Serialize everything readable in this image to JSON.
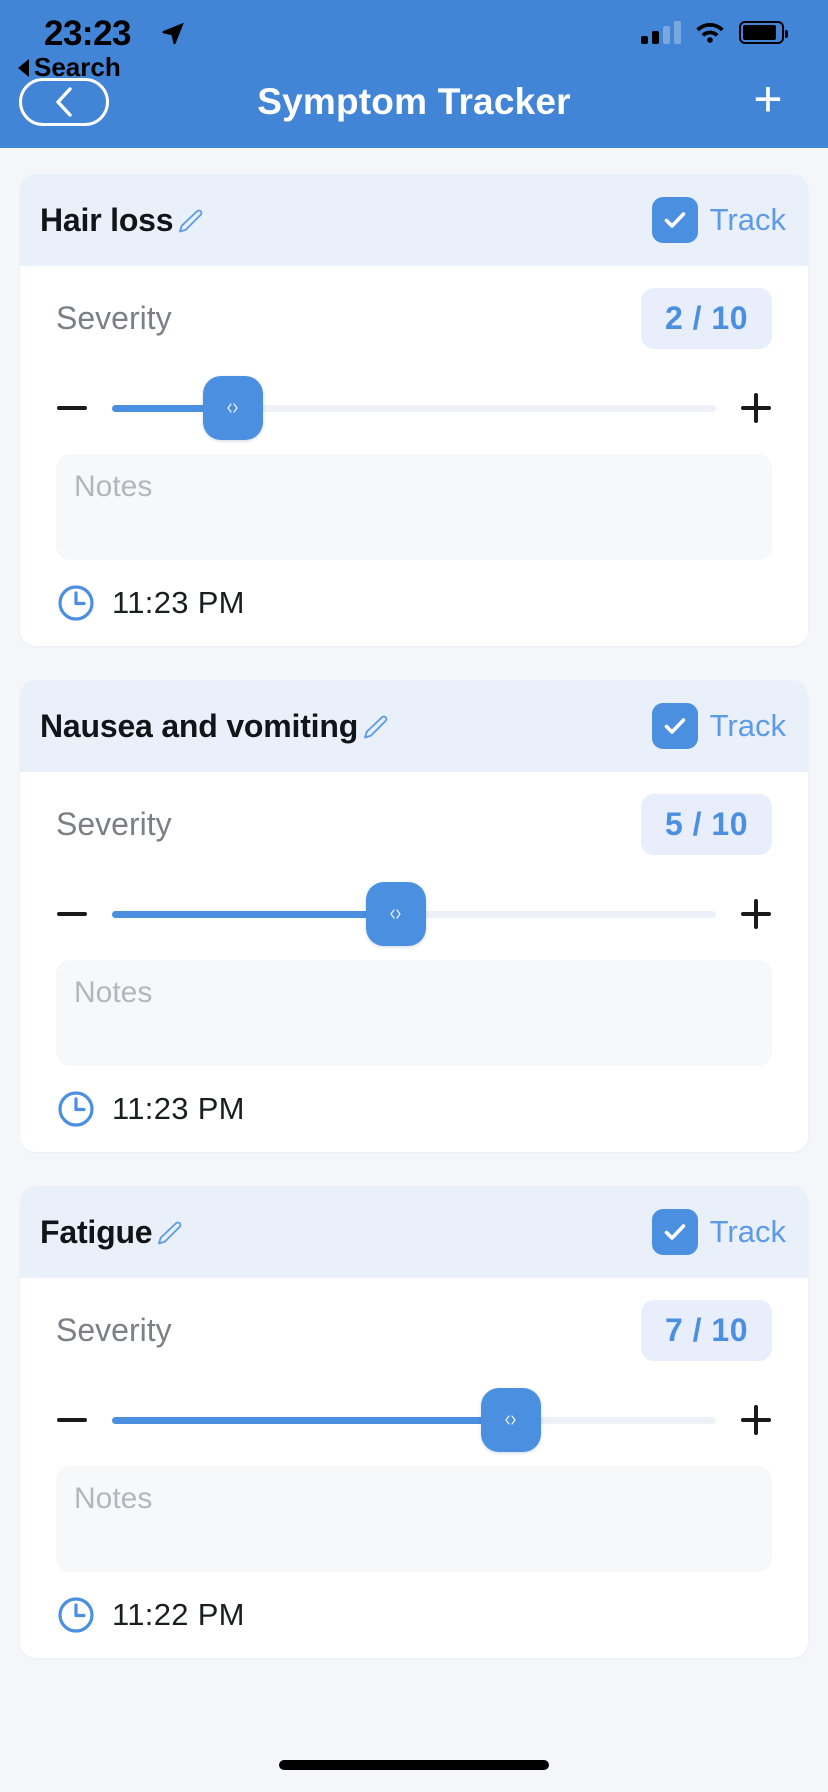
{
  "status_bar": {
    "time": "23:23",
    "location_icon": "location-arrow-icon",
    "signal_icon": "cellular-signal-icon",
    "wifi_icon": "wifi-icon",
    "battery_icon": "battery-icon"
  },
  "nav": {
    "back_link_label": "Search",
    "back_button_icon": "chevron-left-icon",
    "title": "Symptom Tracker",
    "add_button_label": "+"
  },
  "theme": {
    "accent": "#4b8fe0",
    "header_bg": "#4285d6",
    "card_head_bg": "#eaf0fa",
    "page_bg": "#f4f6fa",
    "badge_bg": "#e8eefb",
    "notes_bg": "#f7f8fa",
    "track_label_color": "#5d9ae8"
  },
  "labels": {
    "severity": "Severity",
    "track": "Track",
    "notes_placeholder": "Notes",
    "edit_icon": "pencil-edit-icon",
    "check_icon": "checkmark-icon",
    "clock_icon": "clock-icon",
    "decrement_icon": "minus-icon",
    "increment_icon": "plus-icon",
    "thumb_icon": "left-right-chevrons-icon"
  },
  "symptoms": [
    {
      "name": "Hair loss",
      "tracked": true,
      "severity_label": "Severity",
      "severity_value": 2,
      "severity_max": 10,
      "severity_text": "2 / 10",
      "notes_value": "",
      "time": "11:23 PM"
    },
    {
      "name": "Nausea and vomiting",
      "tracked": true,
      "severity_label": "Severity",
      "severity_value": 5,
      "severity_max": 10,
      "severity_text": "5 / 10",
      "notes_value": "",
      "time": "11:23 PM"
    },
    {
      "name": "Fatigue",
      "tracked": true,
      "severity_label": "Severity",
      "severity_value": 7,
      "severity_max": 10,
      "severity_text": "7 / 10",
      "notes_value": "",
      "time": "11:22 PM"
    }
  ]
}
